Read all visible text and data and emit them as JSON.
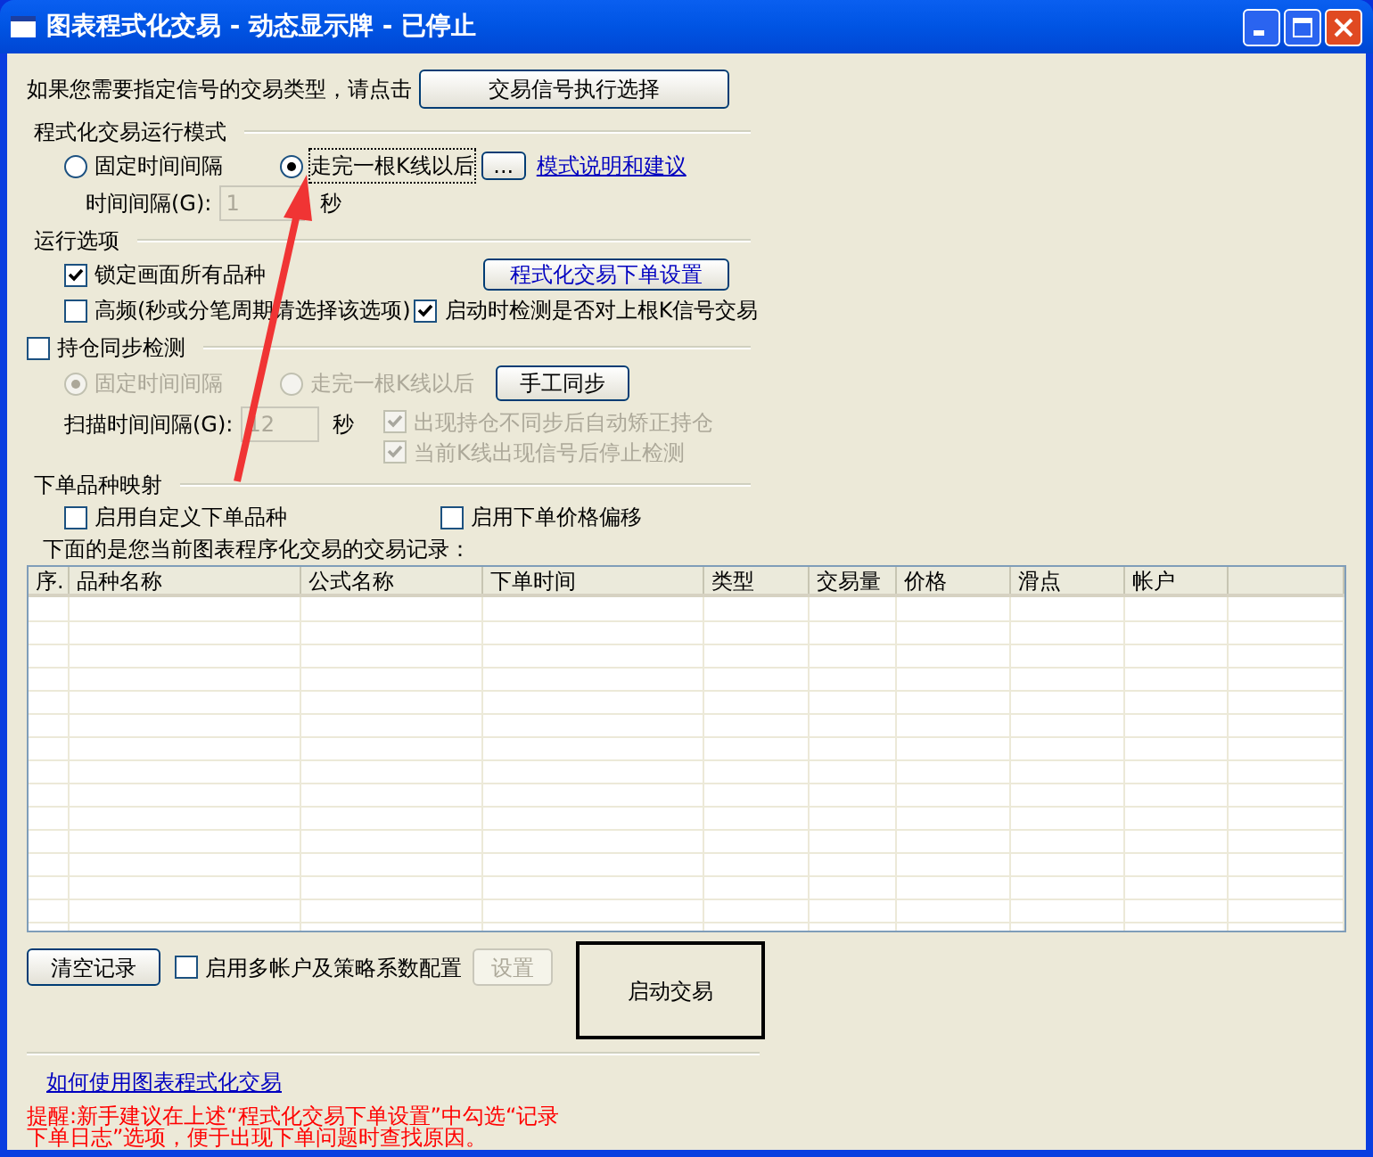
{
  "window": {
    "title": "图表程式化交易 - 动态显示牌 - 已停止"
  },
  "signal_prompt": {
    "text": "如果您需要指定信号的交易类型，请点击",
    "button": "交易信号执行选择"
  },
  "run_mode": {
    "label": "程式化交易运行模式",
    "options": [
      {
        "label": "固定时间间隔",
        "selected": false
      },
      {
        "label": "走完一根K线以后",
        "selected": true
      }
    ],
    "more_button": "...",
    "help_link": "模式说明和建议",
    "interval_label": "时间间隔(G):",
    "interval_value": "1",
    "interval_disabled": true,
    "interval_unit": "秒"
  },
  "run_options": {
    "label": "运行选项",
    "checkboxes": [
      {
        "label": "锁定画面所有品种",
        "checked": true
      },
      {
        "label": "高频(秒或分笔周期请选择该选项)",
        "checked": false
      },
      {
        "label": "启动时检测是否对上根K信号交易",
        "checked": true
      }
    ],
    "settings_button": "程式化交易下单设置"
  },
  "position_sync": {
    "label": "持仓同步检测",
    "checked": false,
    "options": [
      {
        "label": "固定时间间隔",
        "selected": true
      },
      {
        "label": "走完一根K线以后",
        "selected": false
      }
    ],
    "options_disabled": true,
    "sync_button": "手工同步",
    "scan_label": "扫描时间间隔(G):",
    "scan_value": "12",
    "scan_unit": "秒",
    "checkboxes": [
      {
        "label": "出现持仓不同步后自动矫正持仓",
        "checked": true,
        "disabled": true
      },
      {
        "label": "当前K线出现信号后停止检测",
        "checked": true,
        "disabled": true
      }
    ]
  },
  "mapping": {
    "label": "下单品种映射",
    "checkboxes": [
      {
        "label": "启用自定义下单品种",
        "checked": false
      },
      {
        "label": "启用下单价格偏移",
        "checked": false
      }
    ]
  },
  "records": {
    "caption": "下面的是您当前图表程序化交易的交易记录：",
    "columns": [
      "序.",
      "品种名称",
      "公式名称",
      "下单时间",
      "类型",
      "交易量",
      "价格",
      "滑点",
      "帐户"
    ]
  },
  "bottom": {
    "clear_button": "清空记录",
    "multi_account": {
      "label": "启用多帐户及策略系数配置",
      "checked": false
    },
    "setup_button": "设置",
    "setup_disabled": true,
    "start_button": "启动交易",
    "help_link": "如何使用图表程式化交易",
    "tip_lines": [
      "提醒:新手建议在上述“程式化交易下单设置”中勾选“记录",
      "下单日志”选项，便于出现下单问题时查找原因。"
    ]
  }
}
